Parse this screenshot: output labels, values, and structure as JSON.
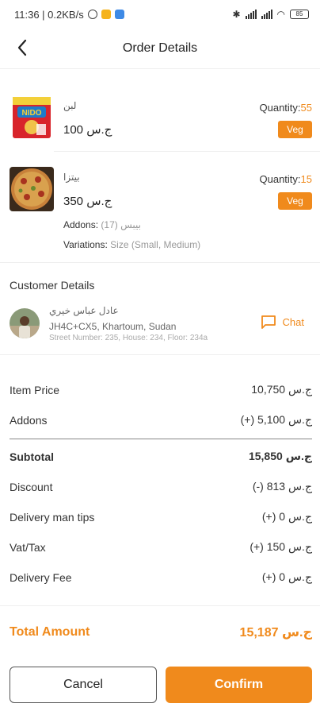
{
  "status_bar": {
    "time_speed": "11:36 | 0.2KB/s",
    "battery": "85"
  },
  "header": {
    "title": "Order Details"
  },
  "items": [
    {
      "name": "لبن",
      "price": "100 ج.س",
      "quantity_label": "Quantity:",
      "quantity_value": "55",
      "badge": "Veg"
    },
    {
      "name": "بيتزا",
      "price": "350 ج.س",
      "quantity_label": "Quantity:",
      "quantity_value": "15",
      "badge": "Veg",
      "addons_label": "Addons:",
      "addons_value": "بيبس (17)",
      "variations_label": "Variations:",
      "variations_value": "Size (Small, Medium)"
    }
  ],
  "customer": {
    "section_title": "Customer Details",
    "name": "عادل عباس خيري",
    "address": "JH4C+CX5, Khartoum, Sudan",
    "street": "Street Number: 235, House: 234, Floor: 234a",
    "chat_label": "Chat"
  },
  "summary": {
    "item_price_label": "Item Price",
    "item_price_value": "10,750 ج.س",
    "addons_label": "Addons",
    "addons_value": "(+) 5,100 ج.س",
    "subtotal_label": "Subtotal",
    "subtotal_value": "15,850 ج.س",
    "discount_label": "Discount",
    "discount_value": "(-) 813 ج.س",
    "tips_label": "Delivery man tips",
    "tips_value": "(+) 0 ج.س",
    "vat_label": "Vat/Tax",
    "vat_value": "(+) 150 ج.س",
    "delivery_fee_label": "Delivery Fee",
    "delivery_fee_value": "(+) 0 ج.س",
    "total_label": "Total Amount",
    "total_value": "15,187 ج.س"
  },
  "actions": {
    "cancel_label": "Cancel",
    "confirm_label": "Confirm"
  },
  "colors": {
    "accent": "#f08a1c"
  }
}
